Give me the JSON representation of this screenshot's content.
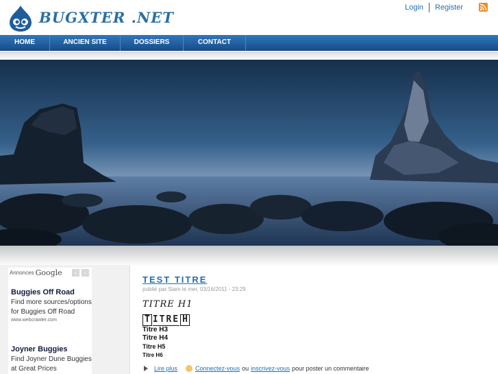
{
  "site": {
    "logo_text": "BUGXTER .NET",
    "user_links": [
      "Login",
      "Register"
    ]
  },
  "nav": {
    "items": [
      {
        "label": "HOME"
      },
      {
        "label": "ANCIEN SITE"
      },
      {
        "label": "DOSSIERS"
      },
      {
        "label": "CONTACT"
      }
    ]
  },
  "ads": {
    "label": "Annonces",
    "brand": "Google",
    "items": [
      {
        "title": "Buggies Off Road",
        "text": "Find more sources/options for Buggies Off Road",
        "url": "www.webcrawler.com"
      },
      {
        "title": "Joyner Buggies",
        "text": "Find Joyner Dune Buggies at Great Prices"
      }
    ]
  },
  "post": {
    "title": "TEST TITRE",
    "meta": "publié par Siam le mer, 03/16/2011 - 23:29",
    "h2_deco": "TITRE H1",
    "h2_box": {
      "first": "T",
      "middle": "ITRE",
      "last": "H"
    },
    "h3": "Titre H3",
    "h4": "Titre H4",
    "h5": "Titre H5",
    "h6": "Titre H6",
    "read_more": "Lire plus",
    "login_link": "Connectez-vous",
    "or_text": "ou",
    "register_link": "inscrivez-vous",
    "comment_text": "pour poster un commentaire"
  },
  "colors": {
    "accent": "#1d6fb3",
    "nav_top": "#2f77bd",
    "nav_bottom": "#174e8b"
  },
  "icons": [
    "drupal-drop-icon",
    "rss-icon",
    "prev-arrow-icon",
    "next-arrow-icon",
    "bullet-arrow-icon",
    "login-icon"
  ]
}
